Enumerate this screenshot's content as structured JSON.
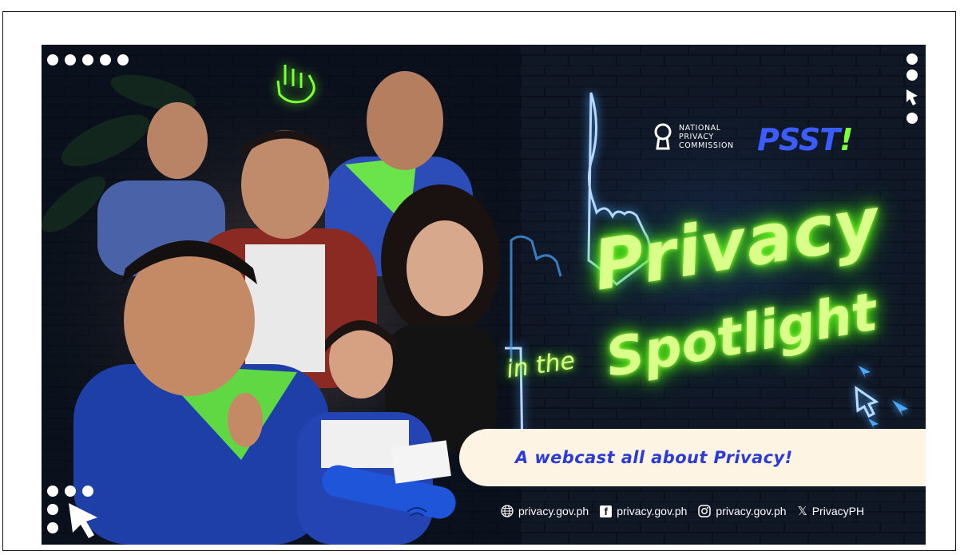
{
  "banner": {
    "title_line1": "Privacy",
    "title_in_the": "in the",
    "title_line2": "Spotlight",
    "tagline": "A webcast all about Privacy!"
  },
  "logos": {
    "npc_line1": "NATIONAL",
    "npc_line2": "PRIVACY",
    "npc_line3": "COMMISSION",
    "psst_main": "PSST",
    "psst_bang": "!"
  },
  "socials": [
    {
      "icon": "globe-icon",
      "label": "privacy.gov.ph"
    },
    {
      "icon": "facebook-icon",
      "label": "privacy.gov.ph"
    },
    {
      "icon": "instagram-icon",
      "label": "privacy.gov.ph"
    },
    {
      "icon": "x-icon",
      "label": "PrivacyPH"
    }
  ],
  "colors": {
    "neon_green": "#9dff3a",
    "neon_blue": "#4aa8ff",
    "brand_blue": "#2a3bd8",
    "pill_cream": "#fdf4e4",
    "background": "#0a0f1a"
  }
}
